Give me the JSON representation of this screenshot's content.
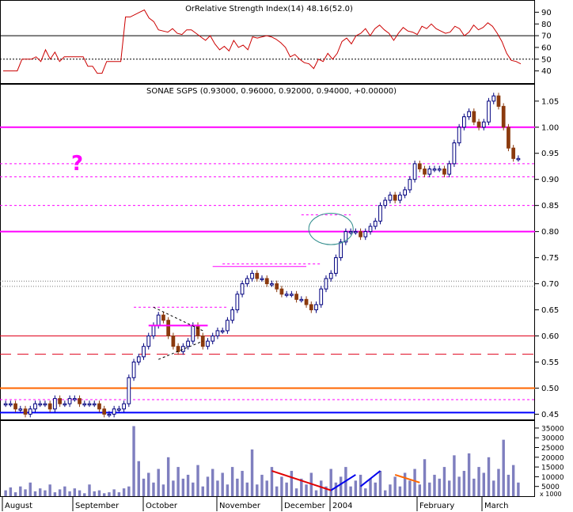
{
  "chart_data": [
    {
      "type": "line",
      "panel": "indicator",
      "title": "OrRelative Strength Index(14) 48.16(52.0)",
      "yticks": [
        40,
        50,
        60,
        70,
        80,
        90
      ],
      "ylim": [
        33,
        95
      ],
      "reference_lines": [
        70,
        50
      ],
      "colors": {
        "line": "#cc0000",
        "reference": "#000000",
        "dotted": "#000000"
      },
      "series": [
        {
          "values": [
            40,
            40,
            40,
            40,
            50,
            50,
            50,
            52,
            48,
            58,
            50,
            56,
            48,
            52,
            52,
            52,
            52,
            52,
            44,
            44,
            38,
            38,
            48,
            48,
            48,
            48,
            86,
            86,
            88,
            90,
            92,
            85,
            82,
            75,
            74,
            73,
            76,
            72,
            71,
            75,
            75,
            72,
            69,
            66,
            70,
            63,
            58,
            61,
            57,
            66,
            60,
            62,
            58,
            69,
            68,
            69,
            70,
            69,
            67,
            64,
            60,
            52,
            54,
            50,
            47,
            46,
            42,
            50,
            48,
            55,
            50,
            55,
            65,
            68,
            63,
            70,
            72,
            76,
            70,
            76,
            79,
            75,
            72,
            66,
            72,
            77,
            74,
            73,
            71,
            78,
            76,
            80,
            76,
            74,
            72,
            73,
            78,
            76,
            70,
            73,
            79,
            75,
            77,
            81,
            78,
            72,
            65,
            55,
            49,
            48,
            46
          ]
        }
      ]
    },
    {
      "type": "candlestick",
      "panel": "price",
      "title": "SONAE SGPS (0.93000, 0.96000, 0.92000, 0.94000, +0.00000)",
      "yticks": [
        "0.45",
        "0.50",
        "0.55",
        "0.60",
        "0.65",
        "0.70",
        "0.75",
        "0.80",
        "0.85",
        "0.90",
        "0.95",
        "1.00",
        "1.05"
      ],
      "ylim": [
        0.44,
        1.08
      ],
      "annotation": "?",
      "up_color": "#00007f",
      "down_color": "#8b3a0e",
      "closes": [
        0.47,
        0.47,
        0.46,
        0.46,
        0.45,
        0.46,
        0.47,
        0.47,
        0.47,
        0.46,
        0.48,
        0.47,
        0.47,
        0.48,
        0.48,
        0.47,
        0.47,
        0.47,
        0.47,
        0.46,
        0.45,
        0.45,
        0.46,
        0.46,
        0.47,
        0.52,
        0.55,
        0.56,
        0.58,
        0.6,
        0.62,
        0.64,
        0.63,
        0.6,
        0.58,
        0.57,
        0.58,
        0.59,
        0.62,
        0.6,
        0.58,
        0.59,
        0.6,
        0.61,
        0.61,
        0.63,
        0.65,
        0.68,
        0.7,
        0.71,
        0.72,
        0.71,
        0.71,
        0.7,
        0.7,
        0.69,
        0.68,
        0.68,
        0.68,
        0.67,
        0.67,
        0.66,
        0.65,
        0.66,
        0.69,
        0.71,
        0.72,
        0.75,
        0.78,
        0.8,
        0.8,
        0.8,
        0.79,
        0.8,
        0.81,
        0.82,
        0.85,
        0.86,
        0.87,
        0.86,
        0.87,
        0.88,
        0.9,
        0.93,
        0.92,
        0.91,
        0.92,
        0.92,
        0.92,
        0.91,
        0.93,
        0.97,
        1.0,
        1.02,
        1.03,
        1.01,
        1.0,
        1.01,
        1.05,
        1.06,
        1.04,
        1.0,
        0.96,
        0.94,
        0.94
      ],
      "horizontal_lines": [
        {
          "value": 1.0,
          "color": "#ff00ff",
          "style": "solid",
          "width": 2
        },
        {
          "value": 0.93,
          "color": "#ff00ff",
          "style": "dashed",
          "width": 1
        },
        {
          "value": 0.905,
          "color": "#ff00ff",
          "style": "dashed",
          "width": 1
        },
        {
          "value": 0.85,
          "color": "#ff00ff",
          "style": "dashed",
          "width": 1
        },
        {
          "value": 0.8,
          "color": "#ff00ff",
          "style": "solid",
          "width": 2
        },
        {
          "value": 0.705,
          "color": "#777777",
          "style": "dotted",
          "width": 1
        },
        {
          "value": 0.695,
          "color": "#777777",
          "style": "dotted",
          "width": 1
        },
        {
          "value": 0.6,
          "color": "#e0001a",
          "style": "solid",
          "width": 1
        },
        {
          "value": 0.565,
          "color": "#e0001a",
          "style": "longdash",
          "width": 1
        },
        {
          "value": 0.5,
          "color": "#ff6600",
          "style": "solid",
          "width": 2
        },
        {
          "value": 0.478,
          "color": "#ff00ff",
          "style": "dashed",
          "width": 1
        },
        {
          "value": 0.453,
          "color": "#0000ff",
          "style": "solid",
          "width": 2
        }
      ]
    },
    {
      "type": "bar",
      "panel": "volume",
      "yticks": [
        "5000",
        "10000",
        "15000",
        "20000",
        "25000",
        "30000",
        "35000"
      ],
      "units_label": "x 1000",
      "ylim": [
        0,
        37000
      ],
      "color": "#7f7fbf",
      "values": [
        3000,
        4500,
        2000,
        5000,
        3500,
        7000,
        2500,
        4000,
        3000,
        6000,
        2000,
        3500,
        5000,
        2500,
        4000,
        3000,
        1500,
        6000,
        2500,
        3000,
        1500,
        2000,
        3500,
        2000,
        4000,
        5000,
        36000,
        18000,
        9000,
        12000,
        7000,
        14000,
        6000,
        20000,
        8000,
        15000,
        9000,
        11000,
        7000,
        16000,
        5000,
        10000,
        14000,
        8000,
        12000,
        6000,
        15000,
        9000,
        13000,
        7000,
        24000,
        6000,
        11000,
        8000,
        15000,
        5000,
        10000,
        7000,
        13000,
        4000,
        9000,
        6000,
        12000,
        3000,
        8000,
        5000,
        14000,
        7000,
        10000,
        15000,
        5000,
        8000,
        11000,
        4000,
        9000,
        7000,
        13000,
        3000,
        6000,
        10000,
        5000,
        12000,
        8000,
        14000,
        6000,
        19000,
        7000,
        11000,
        9000,
        15000,
        8000,
        21000,
        10000,
        13000,
        22000,
        9000,
        15000,
        12000,
        20000,
        8000,
        14000,
        29000,
        11000,
        16000,
        7000
      ],
      "trendlines": [
        {
          "color": "#e00000",
          "from_volume": 13000,
          "to_volume": 3000
        },
        {
          "color": "#0000ee",
          "from_volume": 3000,
          "to_volume": 11000
        },
        {
          "color": "#0000ee",
          "from_volume": 5000,
          "to_volume": 13000
        },
        {
          "color": "#ff6600",
          "from_volume": 11000,
          "to_volume": 7000
        }
      ]
    }
  ],
  "x_axis_labels": [
    "August",
    "September",
    "October",
    "November",
    "December",
    "2004",
    "February",
    "March"
  ]
}
